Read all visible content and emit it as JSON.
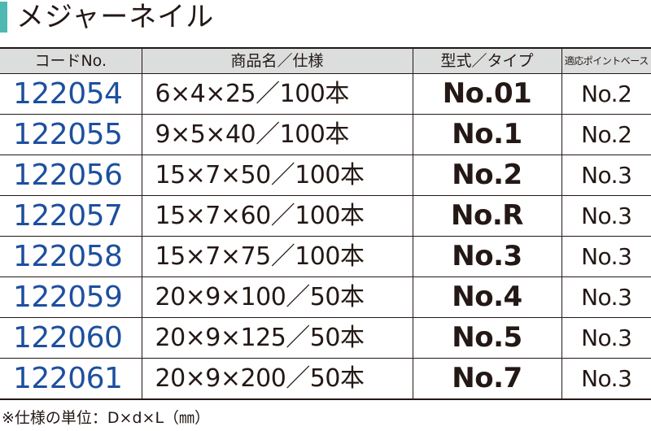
{
  "title": "メジャーネイル",
  "accent_color": "#4fb8b0",
  "header_bg_color": "#dcdddd",
  "code_color": "#1d4f9e",
  "table": {
    "headers": {
      "code": "コードNo.",
      "name": "商品名／仕様",
      "type": "型式／タイプ",
      "base": "適応ポイントベース"
    },
    "rows": [
      {
        "code": "122054",
        "name": "6×4×25／100本",
        "type": "No.01",
        "base": "No.2"
      },
      {
        "code": "122055",
        "name": "9×5×40／100本",
        "type": "No.1",
        "base": "No.2"
      },
      {
        "code": "122056",
        "name": "15×7×50／100本",
        "type": "No.2",
        "base": "No.3"
      },
      {
        "code": "122057",
        "name": "15×7×60／100本",
        "type": "No.R",
        "base": "No.3"
      },
      {
        "code": "122058",
        "name": "15×7×75／100本",
        "type": "No.3",
        "base": "No.3"
      },
      {
        "code": "122059",
        "name": "20×9×100／50本",
        "type": "No.4",
        "base": "No.3"
      },
      {
        "code": "122060",
        "name": "20×9×125／50本",
        "type": "No.5",
        "base": "No.3"
      },
      {
        "code": "122061",
        "name": "20×9×200／50本",
        "type": "No.7",
        "base": "No.3"
      }
    ]
  },
  "footnote": "※仕様の単位：D×d×L（㎜）"
}
